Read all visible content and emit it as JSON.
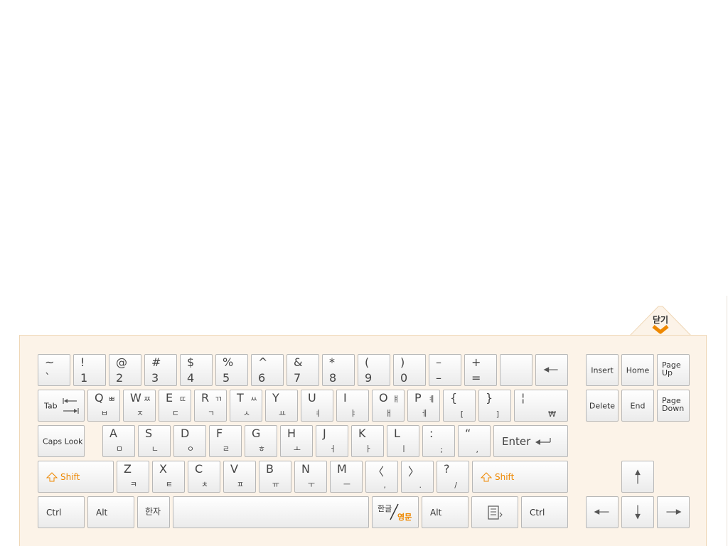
{
  "close_label": "닫기",
  "colors": {
    "panel_bg": "#fcf3e8",
    "panel_border": "#efd7b6",
    "accent": "#ee8800"
  },
  "row1": [
    {
      "top": "~",
      "bot": "`"
    },
    {
      "top": "!",
      "bot": "1"
    },
    {
      "top": "@",
      "bot": "2"
    },
    {
      "top": "#",
      "bot": "3"
    },
    {
      "top": "$",
      "bot": "4"
    },
    {
      "top": "%",
      "bot": "5"
    },
    {
      "top": "^",
      "bot": "6"
    },
    {
      "top": "&",
      "bot": "7"
    },
    {
      "top": "*",
      "bot": "8"
    },
    {
      "top": "(",
      "bot": "9"
    },
    {
      "top": ")",
      "bot": "0"
    },
    {
      "top": "–",
      "bot": "–"
    },
    {
      "top": "+",
      "bot": "="
    },
    {
      "top": "",
      "bot": ""
    }
  ],
  "row2": [
    {
      "top": "Q",
      "ks": "ㅃ",
      "kb": "ㅂ"
    },
    {
      "top": "W",
      "ks": "ㅉ",
      "kb": "ㅈ"
    },
    {
      "top": "E",
      "ks": "ㄸ",
      "kb": "ㄷ"
    },
    {
      "top": "R",
      "ks": "ㄲ",
      "kb": "ㄱ"
    },
    {
      "top": "T",
      "ks": "ㅆ",
      "kb": "ㅅ"
    },
    {
      "top": "Y",
      "ks": "",
      "kb": "ㅛ"
    },
    {
      "top": "U",
      "ks": "",
      "kb": "ㅕ"
    },
    {
      "top": "I",
      "ks": "",
      "kb": "ㅑ"
    },
    {
      "top": "O",
      "ks": "ㅒ",
      "kb": "ㅐ"
    },
    {
      "top": "P",
      "ks": "ㅖ",
      "kb": "ㅔ"
    },
    {
      "top": "{",
      "ks": "",
      "kb": "["
    },
    {
      "top": "}",
      "ks": "",
      "kb": "]"
    },
    {
      "top": "¦",
      "ks": "",
      "kb": "₩"
    }
  ],
  "row3": [
    {
      "top": "A",
      "kb": "ㅁ"
    },
    {
      "top": "S",
      "kb": "ㄴ"
    },
    {
      "top": "D",
      "kb": "ㅇ"
    },
    {
      "top": "F",
      "kb": "ㄹ"
    },
    {
      "top": "G",
      "kb": "ㅎ"
    },
    {
      "top": "H",
      "kb": "ㅗ"
    },
    {
      "top": "J",
      "kb": "ㅓ"
    },
    {
      "top": "K",
      "kb": "ㅏ"
    },
    {
      "top": "L",
      "kb": "ㅣ"
    },
    {
      "top": ":",
      "kb": ";"
    },
    {
      "top": "“",
      "kb": ","
    }
  ],
  "row4": [
    {
      "top": "Z",
      "kb": "ㅋ"
    },
    {
      "top": "X",
      "kb": "ㅌ"
    },
    {
      "top": "C",
      "kb": "ㅊ"
    },
    {
      "top": "V",
      "kb": "ㅍ"
    },
    {
      "top": "B",
      "kb": "ㅠ"
    },
    {
      "top": "N",
      "kb": "ㅜ"
    },
    {
      "top": "M",
      "kb": "ㅡ"
    },
    {
      "top": "〈",
      "kb": ","
    },
    {
      "top": "〉",
      "kb": "."
    },
    {
      "top": "?",
      "kb": "/"
    }
  ],
  "labels": {
    "tab": "Tab",
    "caps": "Caps Look",
    "enter": "Enter",
    "shift": "Shift",
    "ctrl": "Ctrl",
    "alt": "Alt",
    "hanja": "한자",
    "hangul": "한글",
    "english": "영문",
    "insert": "Insert",
    "home": "Home",
    "page_up_1": "Page",
    "page_up_2": "Up",
    "delete": "Delete",
    "end": "End",
    "page_down_1": "Page",
    "page_down_2": "Down"
  }
}
